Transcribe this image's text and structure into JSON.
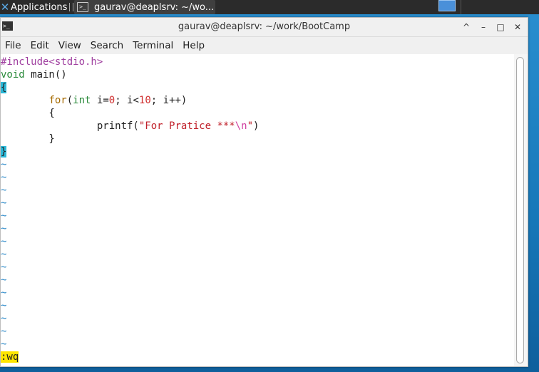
{
  "panel": {
    "applications_label": "Applications",
    "task_label": "gaurav@deaplsrv: ~/wo..."
  },
  "window": {
    "title": "gaurav@deaplsrv: ~/work/BootCamp",
    "buttons": [
      "^",
      "–",
      "□",
      "✕"
    ]
  },
  "menu": [
    "File",
    "Edit",
    "View",
    "Search",
    "Terminal",
    "Help"
  ],
  "editor": {
    "line1_pre": "#include<stdio.h>",
    "line2_type": "void",
    "line2_rest": " main()",
    "line3_brace": "{",
    "line4_indent": "        ",
    "line4_for": "for",
    "line4_p1": "(",
    "line4_int": "int",
    "line4_p2": " i=",
    "line4_n0": "0",
    "line4_p3": "; i<",
    "line4_n10": "10",
    "line4_p4": "; i++)",
    "line5": "        {",
    "line6_indent": "                printf(",
    "line6_str": "\"For Pratice ***",
    "line6_esc": "\\n",
    "line6_strend": "\"",
    "line6_close": ")",
    "line7": "        }",
    "line8_brace": "}",
    "tilde": "~",
    "command": ":wq"
  },
  "colors": {
    "preprocessor": "#a040a0",
    "type": "#2a8a3a",
    "keyword": "#a56a00",
    "number": "#d03030",
    "string": "#c0202a",
    "brace_highlight": "#2bb8d8",
    "tilde": "#2a88c8",
    "command_highlight": "#ffe500"
  }
}
